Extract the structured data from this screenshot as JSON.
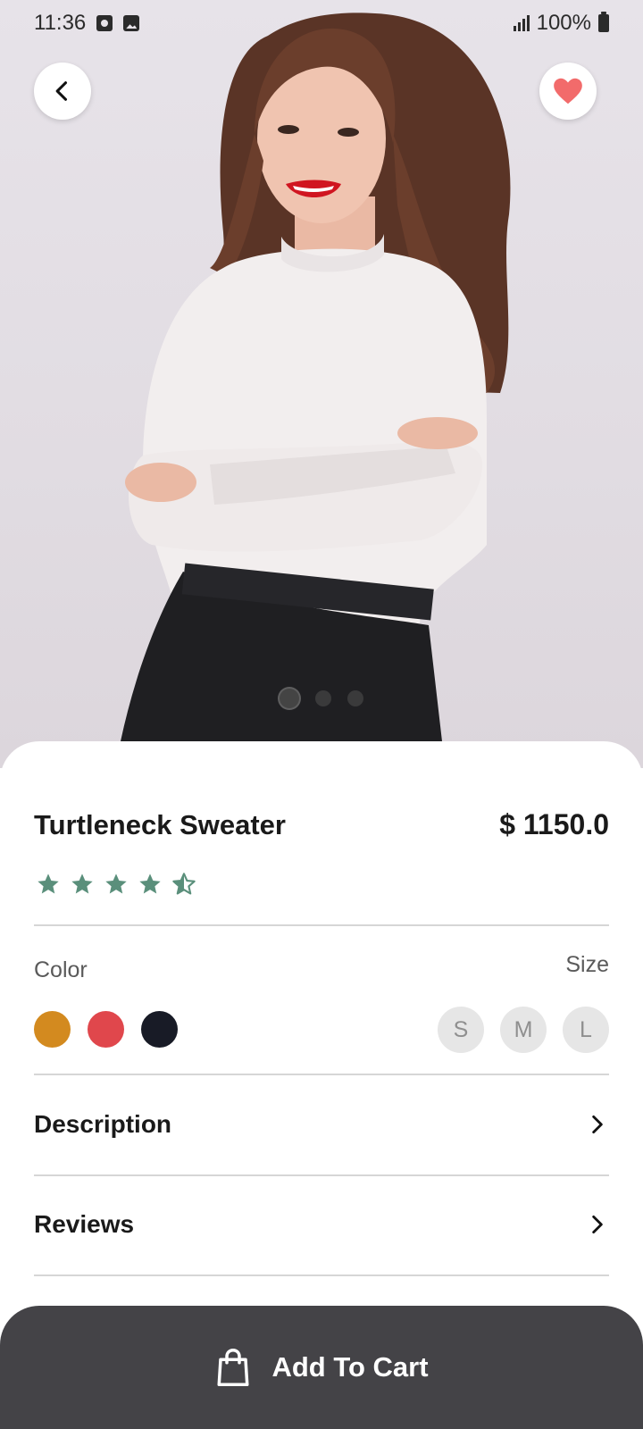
{
  "status_bar": {
    "time": "11:36",
    "battery": "100%"
  },
  "product": {
    "name": "Turtleneck Sweater",
    "price": "$ 1150.0",
    "rating": 4.5,
    "rating_max": 5
  },
  "carousel": {
    "count": 3,
    "active_index": 0
  },
  "options": {
    "color_label": "Color",
    "size_label": "Size",
    "colors": [
      "#D38A1F",
      "#E0474C",
      "#181B26"
    ],
    "sizes": [
      "S",
      "M",
      "L"
    ]
  },
  "sections": {
    "description_label": "Description",
    "reviews_label": "Reviews"
  },
  "cart": {
    "label": "Add To Cart"
  },
  "theme": {
    "accent": "#5A8F7B",
    "favorite": "#F26B6B",
    "cart_bg": "#444347"
  }
}
